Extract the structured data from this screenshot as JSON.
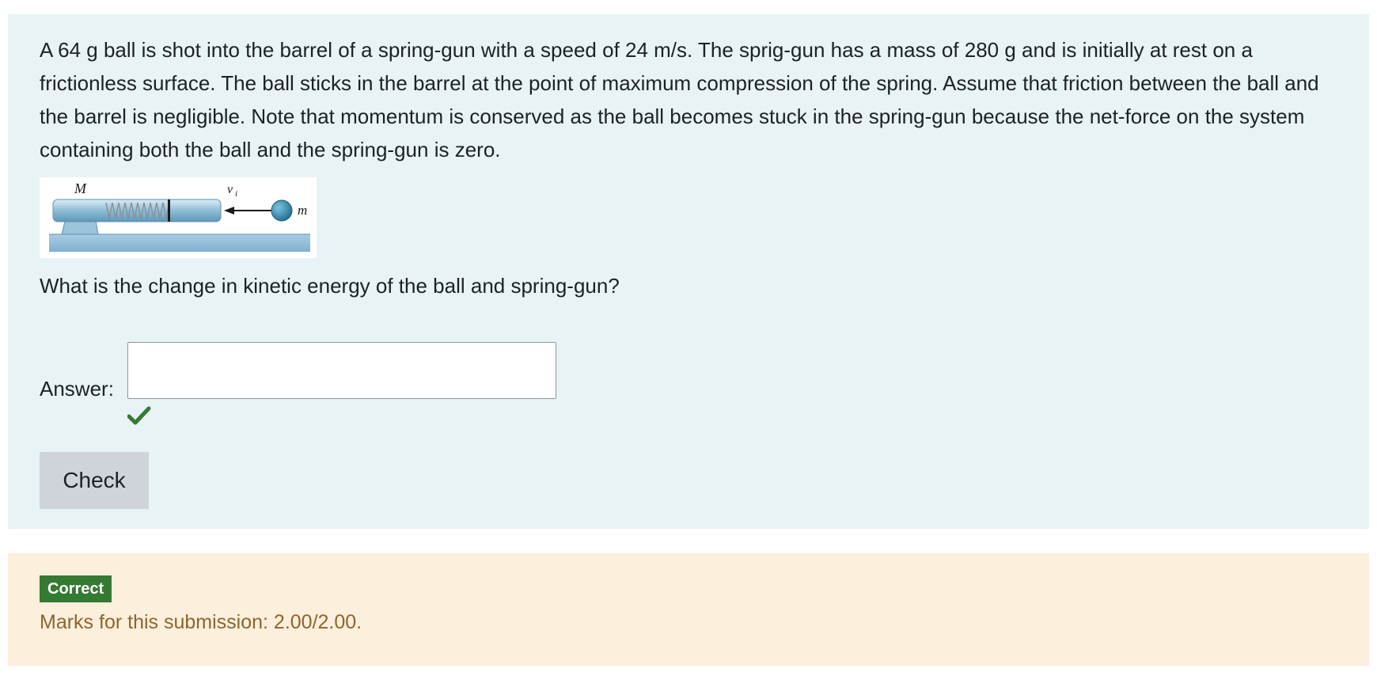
{
  "question": {
    "text": "A 64 g ball is shot into the barrel of a spring-gun with a speed of 24 m/s. The sprig-gun has a mass of 280 g and is initially at rest on a frictionless surface. The ball sticks in the barrel at the point of maximum compression of the spring. Assume that friction between the ball and the barrel is negligible. Note that momentum is conserved as the ball becomes stuck in the spring-gun because the net-force on the system containing both the ball and the spring-gun is zero.",
    "diagram": {
      "label_gun": "M",
      "label_velocity": "v",
      "label_velocity_sub": "i",
      "label_ball": "m"
    },
    "prompt": "What is the change in kinetic energy of the ball and spring-gun?",
    "answer_label": "Answer:",
    "answer_value": "",
    "answer_status_icon": "check-icon",
    "check_button_label": "Check"
  },
  "feedback": {
    "status": "Correct",
    "marks": "Marks for this submission: 2.00/2.00."
  },
  "colors": {
    "question_bg": "#e7f3f5",
    "feedback_bg": "#fcefdc",
    "correct_green": "#357a32",
    "marks_text": "#8e662e",
    "button_bg": "#ced4da"
  }
}
